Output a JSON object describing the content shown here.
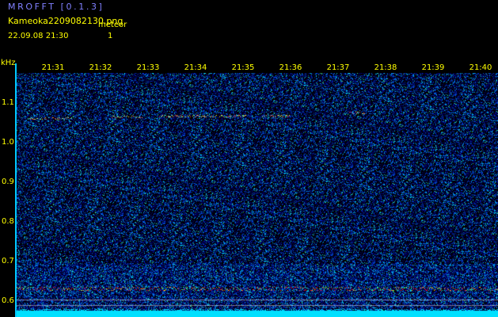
{
  "header": {
    "app_title": "MROFFT [0.1.3]",
    "file_name": "Kameoka2209082130.png",
    "meteor_label": "meteor",
    "timestamp": "22.09.08 21:30",
    "meteor_count": "1"
  },
  "axes": {
    "y_unit": "kHz",
    "y_ticks": [
      "1.1",
      "1.0",
      "0.9",
      "0.8",
      "0.7",
      "0.6"
    ],
    "x_ticks": [
      "21:31",
      "21:32",
      "21:33",
      "21:34",
      "21:35",
      "21:36",
      "21:37",
      "21:38",
      "21:39",
      "21:40"
    ]
  },
  "colors": {
    "background": "#000000",
    "title": "#8080ff",
    "text": "#ffff00",
    "axis": "#00c8ff"
  }
}
